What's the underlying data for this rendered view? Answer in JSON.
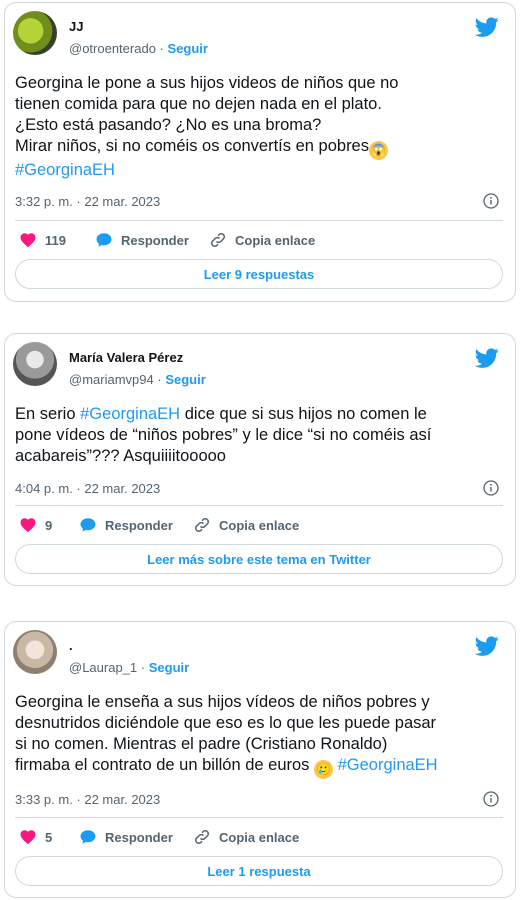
{
  "tweets": [
    {
      "name": "JJ",
      "handle": "@otroenterado",
      "separator": "·",
      "follow": "Seguir",
      "lines": [
        "Georgina le pone a sus hijos videos de niños que no",
        "tienen comida para que no dejen nada en el plato.",
        "¿Esto está pasando? ¿No es una broma?",
        "Mirar niños, si no coméis os convertís en pobres"
      ],
      "hashtag": "#GeorginaEH",
      "timestamp": "3:32 p. m. · 22 mar. 2023",
      "likes": "119",
      "reply": "Responder",
      "copy": "Copia enlace",
      "button": "Leer 9 respuestas"
    },
    {
      "name": "María Valera Pérez",
      "handle": "@mariamvp94",
      "separator": "·",
      "follow": "Seguir",
      "lines_pre": "En serio ",
      "hashtag": "#GeorginaEH",
      "lines_post": " dice que si sus hijos no comen le",
      "line2": "pone vídeos de “niños pobres” y le dice “si no coméis así",
      "line3": "acabareis”??? Asquiiiitooooo",
      "timestamp": "4:04 p. m. · 22 mar. 2023",
      "likes": "9",
      "reply": "Responder",
      "copy": "Copia enlace",
      "button": "Leer más sobre este tema en Twitter"
    },
    {
      "name": ".",
      "handle": "@Laurap_1",
      "separator": "·",
      "follow": "Seguir",
      "lines": [
        "Georgina le enseña a sus hijos vídeos de niños pobres y",
        "desnutridos diciéndole que eso es lo que les puede pasar",
        "si no comen. Mientras el padre (Cristiano Ronaldo)",
        "firmaba el contrato de un billón de euros"
      ],
      "hashtag": "#GeorginaEH",
      "timestamp": "3:33 p. m. · 22 mar. 2023",
      "likes": "5",
      "reply": "Responder",
      "copy": "Copia enlace",
      "button": "Leer 1 respuesta"
    }
  ],
  "icons": {
    "bird": "twitter-bird-icon",
    "heart": "heart-icon",
    "reply": "reply-bubble-icon",
    "link": "link-icon",
    "info": "info-icon"
  },
  "colors": {
    "accent": "#1d9bf0",
    "heart": "#f91880",
    "text": "#0f1419",
    "muted": "#536471",
    "border": "#cfd9de"
  }
}
